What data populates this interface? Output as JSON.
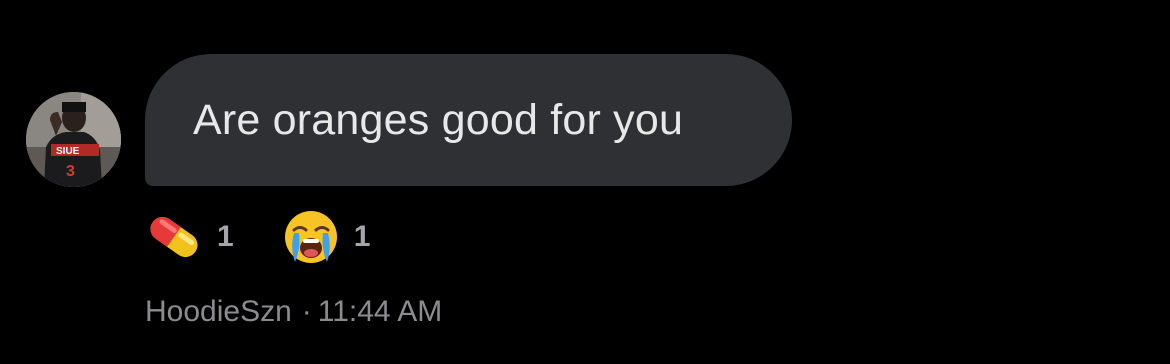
{
  "message": {
    "text": "Are oranges good for you",
    "sender": "HoodieSzn",
    "separator": "·",
    "timestamp": "11:44 AM",
    "avatar_icon": "user-avatar-photo"
  },
  "reactions": [
    {
      "emoji": "pill",
      "count": "1"
    },
    {
      "emoji": "loudly-crying-face",
      "count": "1"
    }
  ],
  "colors": {
    "background": "#000000",
    "bubble": "#2f3033",
    "bubble_text": "#e8e8e8",
    "meta_text": "#8c8c8f",
    "reaction_count": "#a5a5a8"
  }
}
